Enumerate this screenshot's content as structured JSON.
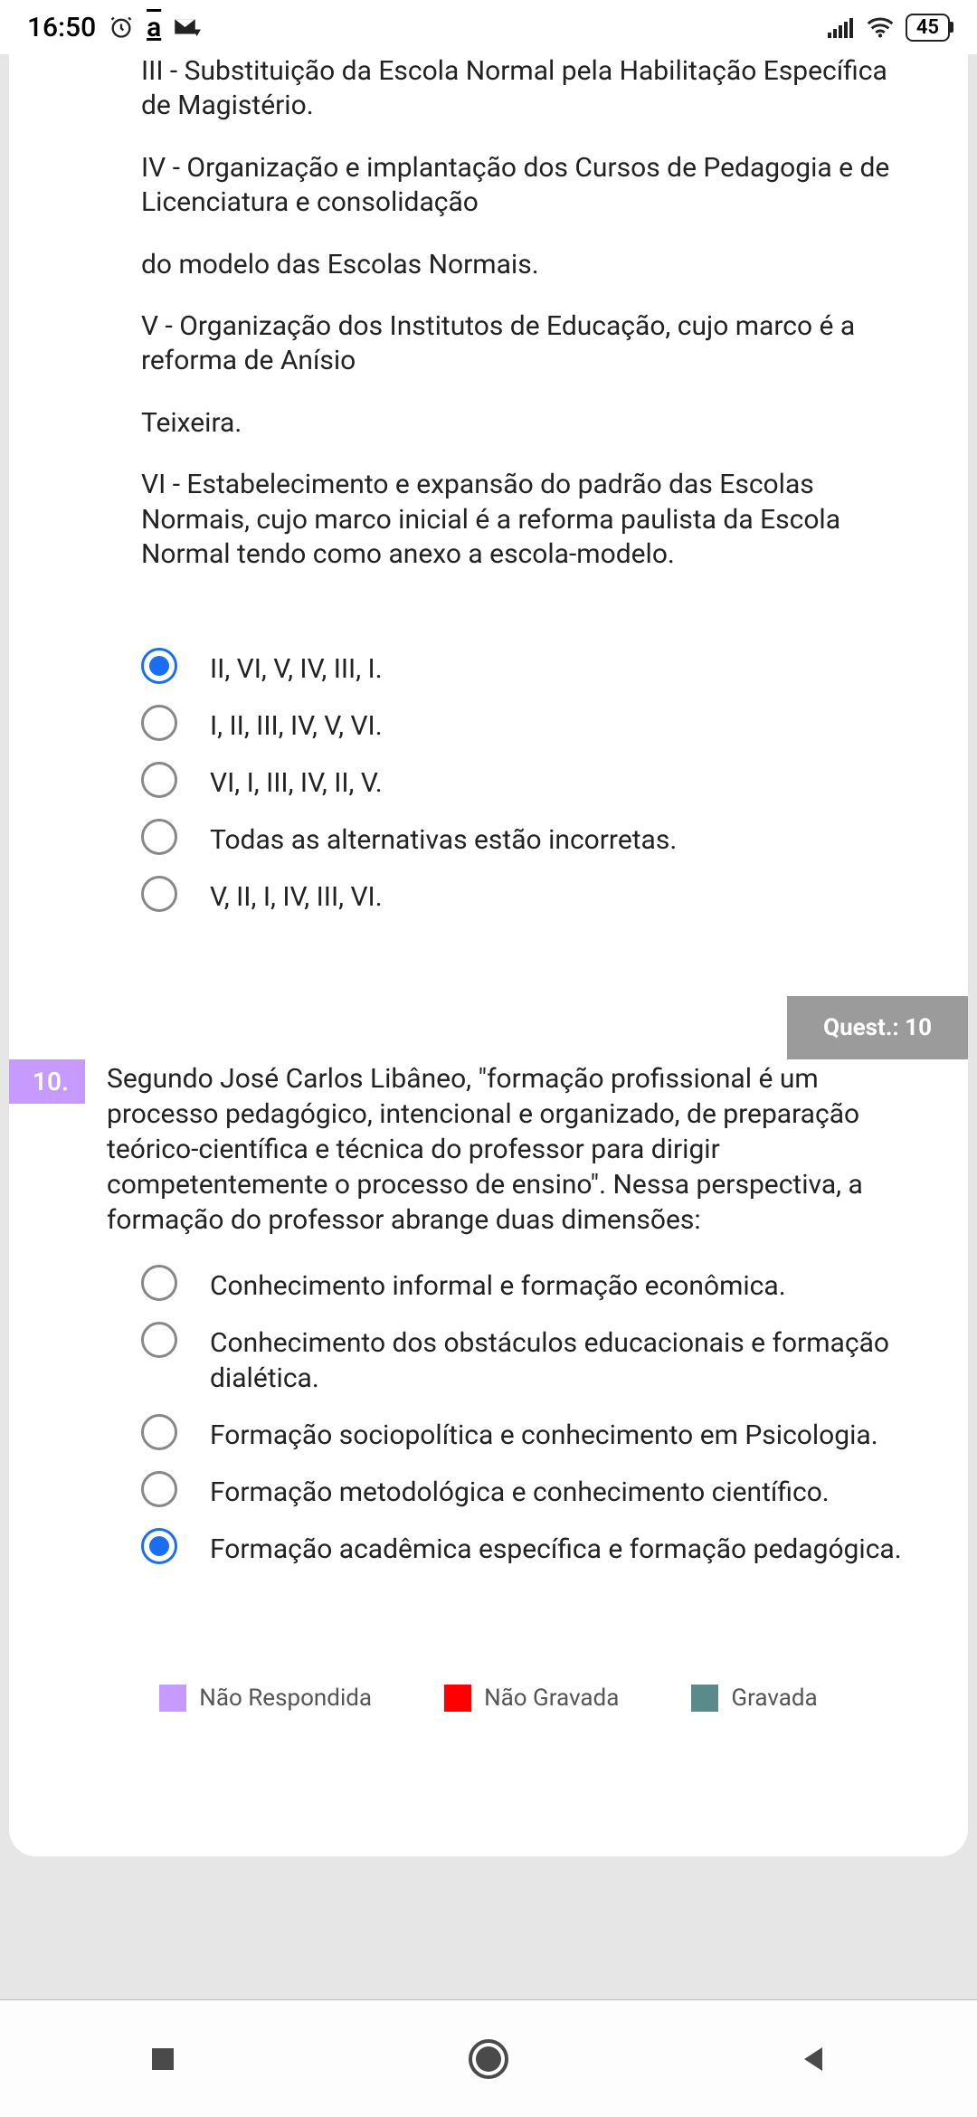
{
  "status": {
    "time": "16:50",
    "battery": "45"
  },
  "q9": {
    "paragraphs": [
      "III - Substituição da Escola Normal pela Habilitação Específica de Magistério.",
      "IV - Organização e implantação dos Cursos de Pedagogia e de Licenciatura e consolidação",
      "do modelo das Escolas Normais.",
      "V - Organização dos Institutos de Educação, cujo marco é a reforma de Anísio",
      "Teixeira.",
      "VI - Estabelecimento e expansão do padrão das Escolas Normais, cujo marco inicial é a reforma paulista da Escola Normal tendo como anexo a escola-modelo."
    ],
    "options": [
      "II, VI, V, IV, III, I.",
      "I, II, III, IV, V, VI.",
      "VI, I, III, IV, II, V.",
      "Todas as alternativas estão incorretas.",
      "V, II, I, IV, III, VI."
    ],
    "selected_index": 0
  },
  "quest_badge": "Quest.: 10",
  "q10": {
    "number": "10.",
    "text": "Segundo José Carlos Libâneo, \"formação profissional é um processo pedagógico, intencional e organizado, de preparação teórico-científica e técnica do professor para dirigir competentemente o processo de ensino\". Nessa perspectiva, a formação do professor abrange duas dimensões:",
    "options": [
      "Conhecimento informal e formação econômica.",
      "Conhecimento dos obstáculos educacionais e formação dialética.",
      "Formação sociopolítica e conhecimento em Psicologia.",
      "Formação metodológica e conhecimento científico.",
      "Formação acadêmica específica e formação pedagógica."
    ],
    "selected_index": 4
  },
  "legend": {
    "items": [
      {
        "label": "Não Respondida",
        "color": "#c79aff"
      },
      {
        "label": "Não Gravada",
        "color": "#ff0000"
      },
      {
        "label": "Gravada",
        "color": "#5a8a8a"
      }
    ]
  }
}
